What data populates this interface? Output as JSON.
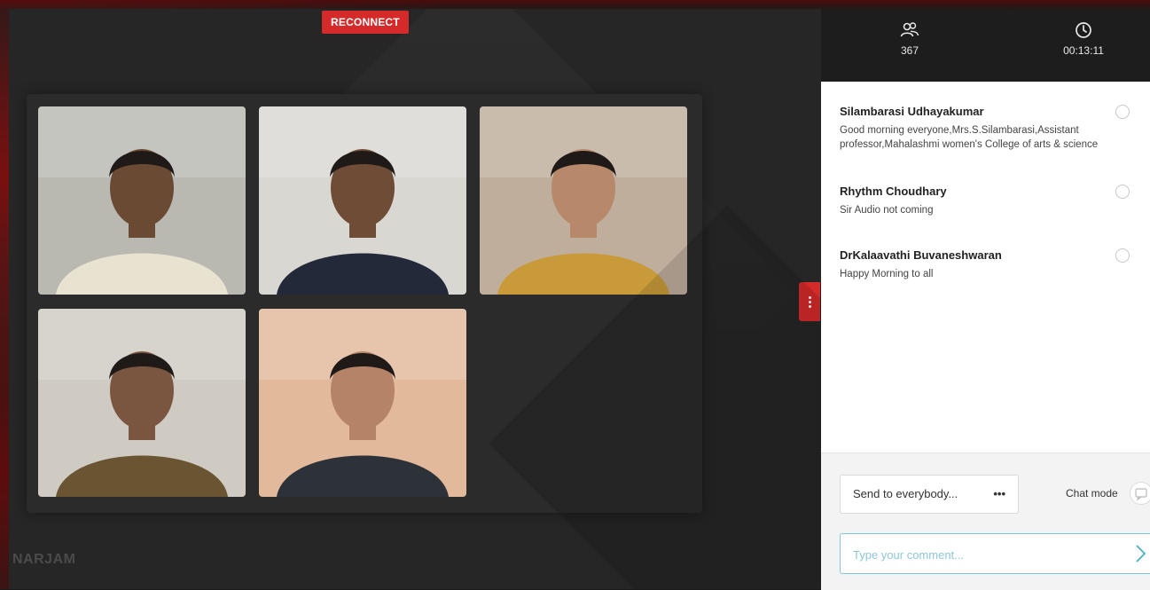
{
  "stage": {
    "reconnect_label": "RECONNECT",
    "watermark": "NARJAM",
    "tiles": [
      {
        "name": "participant-1",
        "bg": "#b9b9b2",
        "shirt": "#e8e2d0",
        "skin": "#6b4a33"
      },
      {
        "name": "participant-2",
        "bg": "#d9d7d2",
        "shirt": "#24293a",
        "skin": "#6e4c36"
      },
      {
        "name": "participant-3",
        "bg": "#bfae9c",
        "shirt": "#c99a3a",
        "skin": "#b7896a"
      },
      {
        "name": "participant-4",
        "bg": "#cfcac2",
        "shirt": "#6a5432",
        "skin": "#7a5540"
      },
      {
        "name": "participant-5",
        "bg": "#e2b99a",
        "shirt": "#2d3138",
        "skin": "#b58468"
      }
    ]
  },
  "header": {
    "participants_icon": "users-icon",
    "participants_count": "367",
    "timer_icon": "clock-icon",
    "timer_value": "00:13:11"
  },
  "chat": {
    "messages": [
      {
        "author": "Silambarasi Udhayakumar",
        "text": "Good morning everyone,Mrs.S.Silambarasi,Assistant professor,Mahalashmi women's College of arts & science"
      },
      {
        "author": "Rhythm Choudhary",
        "text": "Sir Audio not coming"
      },
      {
        "author": "DrKalaavathi Buvaneshwaran",
        "text": "Happy Morning to all"
      }
    ]
  },
  "composer": {
    "recipient_label": "Send to everybody...",
    "recipient_more": "•••",
    "chat_mode_label": "Chat mode",
    "comment_placeholder": "Type your comment...",
    "send_icon": "chevron-right-icon"
  },
  "colors": {
    "accent_red": "#d42a2a",
    "input_border": "#7fc6dc"
  }
}
